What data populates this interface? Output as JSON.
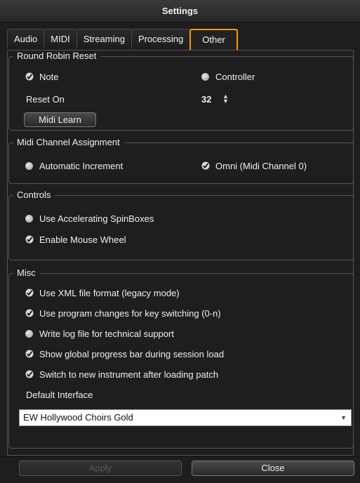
{
  "window": {
    "title": "Settings"
  },
  "tabs": [
    {
      "label": "Audio",
      "active": false
    },
    {
      "label": "MIDI",
      "active": false
    },
    {
      "label": "Streaming",
      "active": false
    },
    {
      "label": "Processing",
      "active": false
    },
    {
      "label": "Other",
      "active": true
    }
  ],
  "round_robin": {
    "title": "Round Robin Reset",
    "note_label": "Note",
    "note_selected": true,
    "controller_label": "Controller",
    "controller_selected": false,
    "reset_on_label": "Reset On",
    "reset_on_value": "32",
    "midi_learn_label": "Midi Learn"
  },
  "midi_channel": {
    "title": "Midi Channel Assignment",
    "auto_label": "Automatic Increment",
    "auto_selected": false,
    "omni_label": "Omni (Midi Channel 0)",
    "omni_selected": true
  },
  "controls": {
    "title": "Controls",
    "accel_label": "Use Accelerating SpinBoxes",
    "accel_checked": false,
    "wheel_label": "Enable Mouse Wheel",
    "wheel_checked": true
  },
  "misc": {
    "title": "Misc",
    "xml_label": "Use XML file format (legacy mode)",
    "xml_checked": true,
    "program_label": "Use program changes for key switching (0-n)",
    "program_checked": true,
    "log_label": "Write log file for technical support",
    "log_checked": false,
    "progress_label": "Show global progress bar during session load",
    "progress_checked": true,
    "switch_label": "Switch to new instrument after loading patch",
    "switch_checked": true,
    "default_interface_label": "Default Interface",
    "default_interface_value": "EW Hollywood Choirs Gold"
  },
  "footer": {
    "apply_label": "Apply",
    "apply_enabled": false,
    "close_label": "Close"
  },
  "colors": {
    "active_tab_border": "#f59a12",
    "background": "#1e1e1e"
  }
}
